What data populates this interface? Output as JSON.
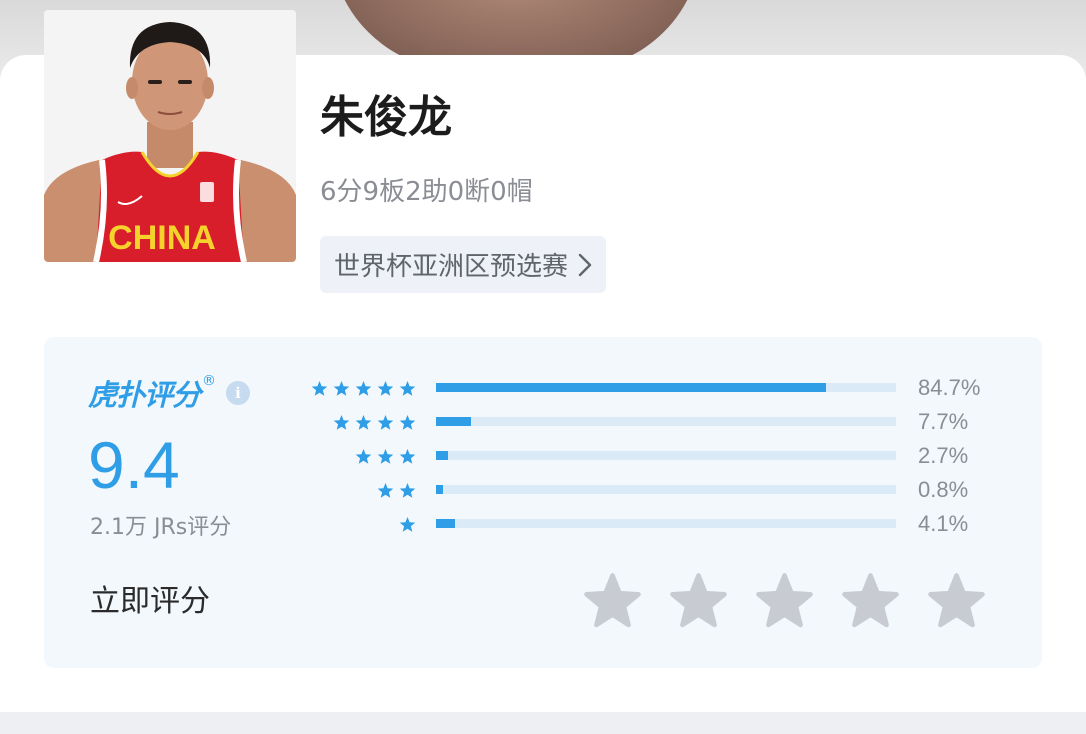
{
  "player": {
    "name": "朱俊龙",
    "stats": "6分9板2助0断0帽",
    "league": "世界杯亚洲区预选赛",
    "jersey_text": "CHINA"
  },
  "rating": {
    "brand": "虎扑评分",
    "brand_mark": "®",
    "info_glyph": "i",
    "score": "9.4",
    "count_text": "2.1万 JRs评分",
    "distribution": [
      {
        "stars": 5,
        "percent": 84.7,
        "label": "84.7%"
      },
      {
        "stars": 4,
        "percent": 7.7,
        "label": "7.7%"
      },
      {
        "stars": 3,
        "percent": 2.7,
        "label": "2.7%"
      },
      {
        "stars": 2,
        "percent": 0.8,
        "label": "0.8%"
      },
      {
        "stars": 1,
        "percent": 4.1,
        "label": "4.1%"
      }
    ],
    "rate_now_label": "立即评分",
    "rate_star_count": 5
  },
  "colors": {
    "accent": "#2f9ee6",
    "track": "#dbeaf7",
    "empty_star": "#c8cbd2",
    "jersey_red": "#d81e2a",
    "jersey_yellow": "#f6d32c"
  },
  "icons": {
    "league_chevron": "chevron-right-icon",
    "small_star": "star-icon",
    "rate_star": "star-outline-icon",
    "info": "info-icon"
  }
}
